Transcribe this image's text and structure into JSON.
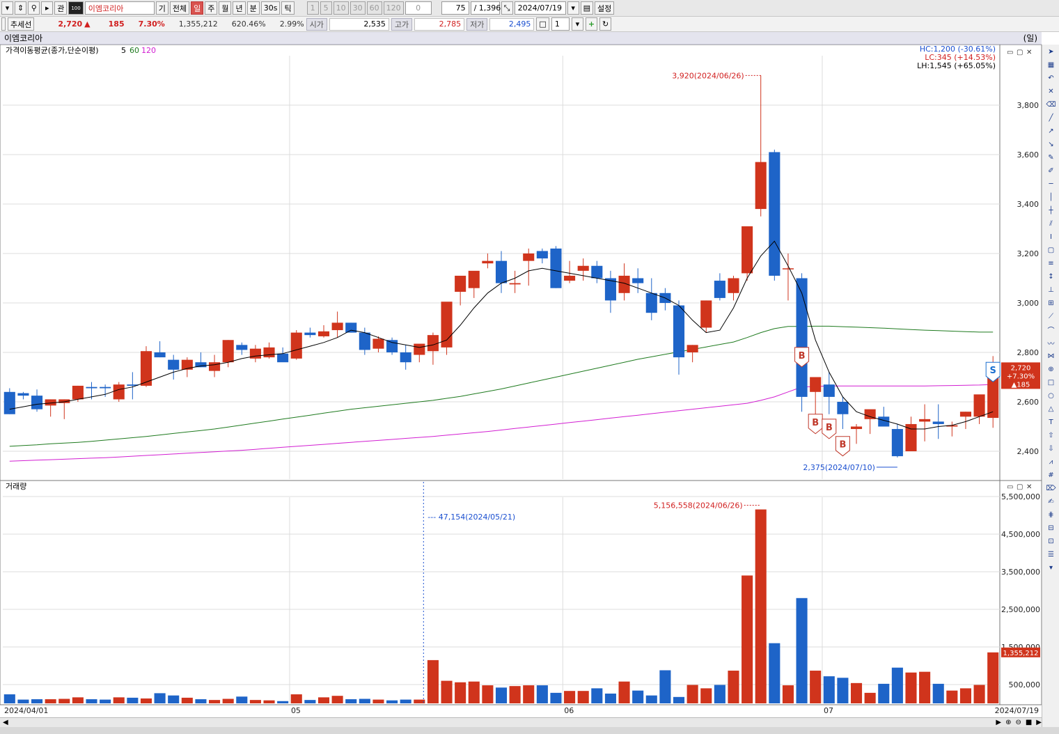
{
  "toolbar": {
    "stock_name": "이엠코리아",
    "btn_gi": "기",
    "btn_all": "전체",
    "periods": [
      "일",
      "주",
      "월",
      "년",
      "분",
      "30s",
      "틱"
    ],
    "selected_period": "일",
    "intervals": [
      "1",
      "5",
      "10",
      "30",
      "60",
      "120"
    ],
    "spinner_value": "0",
    "view_count": "75",
    "total_count": "/ 1,396",
    "date": "2024/07/19",
    "settings_label": "설정",
    "btn_gwan": "관",
    "btn_100a": "100",
    "btn_100b": "100"
  },
  "quote": {
    "trend_btn": "추세선",
    "price": "2,720",
    "arrow": "▲",
    "change": "185",
    "change_pct": "7.30%",
    "volume": "1,355,212",
    "vol_ratio": "620.46%",
    "turnover": "2.99%",
    "open_label": "시가",
    "open": "2,535",
    "high_label": "고가",
    "high": "2,785",
    "low_label": "저가",
    "low": "2,495",
    "compare_value": "1"
  },
  "chart_title": "이엠코리아",
  "chart_unit": "(일)",
  "price_panel": {
    "label": "가격이동평균(종가,단순이평)",
    "ma_periods": [
      "5",
      "60",
      "120"
    ],
    "ma_colors": [
      "#000000",
      "#1e7a1e",
      "#d21ed2"
    ],
    "hc": "HC:1,200 (-30.61%)",
    "lc": "LC:345 (+14.53%)",
    "lh": "LH:1,545 (+65.05%)",
    "high_annotation": "3,920(2024/06/26)",
    "low_annotation": "2,375(2024/07/10)",
    "current_price_tag": [
      "2,720",
      "+7.30%",
      "▲185"
    ],
    "y_ticks": [
      "3,800",
      "3,600",
      "3,400",
      "3,200",
      "3,000",
      "2,800",
      "2,600",
      "2,400"
    ],
    "signal_buy": "B",
    "signal_sell": "S"
  },
  "volume_panel": {
    "label": "거래량",
    "max_annotation": "5,156,558(2024/06/26)",
    "cursor_annotation": "47,154(2024/05/21)",
    "current_tag": "1,355,212",
    "y_ticks": [
      "5,500,000",
      "4,500,000",
      "3,500,000",
      "2,500,000",
      "1,500,000",
      "500,000"
    ]
  },
  "x_axis": {
    "labels": [
      "2024/04/01",
      "05",
      "06",
      "07"
    ],
    "end_label": "2024/07/19"
  },
  "chart_data": {
    "type": "candlestick",
    "up_color": "#d0341c",
    "down_color": "#1e64c8",
    "candles": [
      [
        2640,
        2655,
        2550,
        2550
      ],
      [
        2635,
        2640,
        2610,
        2625
      ],
      [
        2625,
        2650,
        2560,
        2570
      ],
      [
        2585,
        2610,
        2540,
        2610
      ],
      [
        2595,
        2610,
        2530,
        2610
      ],
      [
        2610,
        2665,
        2600,
        2665
      ],
      [
        2660,
        2680,
        2610,
        2655
      ],
      [
        2660,
        2670,
        2620,
        2655
      ],
      [
        2610,
        2680,
        2600,
        2670
      ],
      [
        2670,
        2720,
        2610,
        2665
      ],
      [
        2665,
        2825,
        2660,
        2805
      ],
      [
        2800,
        2845,
        2780,
        2780
      ],
      [
        2770,
        2790,
        2690,
        2730
      ],
      [
        2730,
        2780,
        2700,
        2770
      ],
      [
        2760,
        2800,
        2740,
        2740
      ],
      [
        2725,
        2790,
        2700,
        2760
      ],
      [
        2760,
        2850,
        2740,
        2850
      ],
      [
        2830,
        2840,
        2790,
        2810
      ],
      [
        2775,
        2830,
        2760,
        2815
      ],
      [
        2780,
        2840,
        2775,
        2820
      ],
      [
        2795,
        2820,
        2770,
        2760
      ],
      [
        2775,
        2890,
        2770,
        2880
      ],
      [
        2880,
        2900,
        2860,
        2870
      ],
      [
        2865,
        2910,
        2860,
        2885
      ],
      [
        2890,
        2965,
        2860,
        2920
      ],
      [
        2920,
        2920,
        2880,
        2880
      ],
      [
        2880,
        2900,
        2790,
        2810
      ],
      [
        2815,
        2865,
        2800,
        2855
      ],
      [
        2850,
        2860,
        2790,
        2800
      ],
      [
        2800,
        2830,
        2730,
        2760
      ],
      [
        2790,
        2820,
        2760,
        2835
      ],
      [
        2805,
        2880,
        2750,
        2870
      ],
      [
        2820,
        3000,
        2790,
        3005
      ],
      [
        3045,
        3090,
        2990,
        3110
      ],
      [
        3060,
        3120,
        3020,
        3130
      ],
      [
        3160,
        3200,
        3140,
        3170
      ],
      [
        3170,
        3210,
        3040,
        3080
      ],
      [
        3075,
        3130,
        3040,
        3080
      ],
      [
        3170,
        3220,
        3070,
        3200
      ],
      [
        3210,
        3220,
        3160,
        3180
      ],
      [
        3220,
        3230,
        3060,
        3060
      ],
      [
        3090,
        3170,
        3080,
        3110
      ],
      [
        3130,
        3180,
        3090,
        3150
      ],
      [
        3150,
        3170,
        3080,
        3100
      ],
      [
        3100,
        3130,
        2960,
        3010
      ],
      [
        3040,
        3160,
        3010,
        3110
      ],
      [
        3100,
        3140,
        3040,
        3080
      ],
      [
        3040,
        3100,
        2930,
        2960
      ],
      [
        3040,
        3060,
        2970,
        3000
      ],
      [
        2990,
        3010,
        2710,
        2780
      ],
      [
        2800,
        2830,
        2760,
        2830
      ],
      [
        2900,
        3010,
        2880,
        3010
      ],
      [
        3090,
        3120,
        3010,
        3020
      ],
      [
        3040,
        3110,
        3010,
        3100
      ],
      [
        3120,
        3140,
        3090,
        3310
      ],
      [
        3380,
        3920,
        3350,
        3570
      ],
      [
        3610,
        3620,
        3090,
        3110
      ],
      [
        3140,
        3200,
        3010,
        3140
      ],
      [
        3100,
        3120,
        2560,
        2620
      ],
      [
        2640,
        2670,
        2540,
        2700
      ],
      [
        2670,
        2720,
        2550,
        2620
      ],
      [
        2600,
        2620,
        2490,
        2550
      ],
      [
        2490,
        2510,
        2430,
        2500
      ],
      [
        2530,
        2560,
        2470,
        2570
      ],
      [
        2540,
        2580,
        2500,
        2500
      ],
      [
        2490,
        2510,
        2375,
        2380
      ],
      [
        2400,
        2540,
        2400,
        2510
      ],
      [
        2520,
        2590,
        2440,
        2530
      ],
      [
        2520,
        2590,
        2450,
        2510
      ],
      [
        2500,
        2520,
        2460,
        2505
      ],
      [
        2540,
        2560,
        2490,
        2560
      ],
      [
        2540,
        2600,
        2510,
        2630
      ],
      [
        2535,
        2785,
        2495,
        2720
      ]
    ],
    "ma5": [
      2570,
      2580,
      2590,
      2595,
      2600,
      2610,
      2620,
      2630,
      2650,
      2660,
      2680,
      2700,
      2720,
      2735,
      2745,
      2750,
      2760,
      2775,
      2785,
      2790,
      2795,
      2810,
      2825,
      2840,
      2860,
      2890,
      2880,
      2860,
      2840,
      2830,
      2820,
      2830,
      2850,
      2910,
      2980,
      3040,
      3080,
      3100,
      3130,
      3140,
      3130,
      3120,
      3110,
      3100,
      3090,
      3080,
      3060,
      3040,
      3020,
      2990,
      2930,
      2880,
      2890,
      2980,
      3100,
      3190,
      3250,
      3150,
      3040,
      2850,
      2720,
      2620,
      2560,
      2540,
      2525,
      2510,
      2490,
      2490,
      2500,
      2505,
      2520,
      2540,
      2560
    ],
    "ma60": [
      2420,
      2423,
      2426,
      2430,
      2433,
      2436,
      2440,
      2445,
      2450,
      2455,
      2460,
      2466,
      2472,
      2478,
      2484,
      2490,
      2498,
      2506,
      2514,
      2522,
      2530,
      2538,
      2546,
      2554,
      2562,
      2570,
      2576,
      2582,
      2588,
      2594,
      2600,
      2606,
      2614,
      2622,
      2632,
      2642,
      2652,
      2664,
      2676,
      2688,
      2700,
      2712,
      2724,
      2736,
      2748,
      2760,
      2772,
      2782,
      2792,
      2802,
      2812,
      2822,
      2832,
      2842,
      2860,
      2880,
      2896,
      2905,
      2905,
      2906,
      2906,
      2904,
      2902,
      2900,
      2898,
      2895,
      2892,
      2890,
      2888,
      2886,
      2884,
      2882,
      2882
    ],
    "ma120": [
      2360,
      2362,
      2364,
      2366,
      2368,
      2370,
      2372,
      2374,
      2377,
      2380,
      2383,
      2386,
      2389,
      2392,
      2395,
      2398,
      2401,
      2404,
      2408,
      2412,
      2416,
      2420,
      2424,
      2428,
      2432,
      2436,
      2440,
      2444,
      2448,
      2452,
      2456,
      2460,
      2465,
      2470,
      2475,
      2480,
      2486,
      2492,
      2498,
      2504,
      2510,
      2516,
      2522,
      2528,
      2534,
      2540,
      2546,
      2552,
      2558,
      2564,
      2570,
      2576,
      2582,
      2588,
      2594,
      2606,
      2620,
      2640,
      2660,
      2662,
      2664,
      2664,
      2664,
      2664,
      2664,
      2664,
      2664,
      2664,
      2665,
      2666,
      2667,
      2668,
      2670
    ],
    "volumes": [
      240000,
      100000,
      110000,
      110000,
      120000,
      160000,
      110000,
      100000,
      160000,
      150000,
      130000,
      270000,
      210000,
      150000,
      110000,
      90000,
      120000,
      180000,
      90000,
      80000,
      60000,
      240000,
      90000,
      160000,
      200000,
      110000,
      120000,
      100000,
      80000,
      100000,
      100000,
      1150000,
      600000,
      560000,
      580000,
      480000,
      420000,
      460000,
      480000,
      480000,
      280000,
      330000,
      330000,
      400000,
      260000,
      580000,
      340000,
      210000,
      880000,
      170000,
      490000,
      400000,
      490000,
      870000,
      3400000,
      5156558,
      1600000,
      480000,
      2800000,
      870000,
      720000,
      680000,
      540000,
      280000,
      520000,
      950000,
      820000,
      840000,
      520000,
      340000,
      400000,
      490000,
      1355212
    ]
  }
}
